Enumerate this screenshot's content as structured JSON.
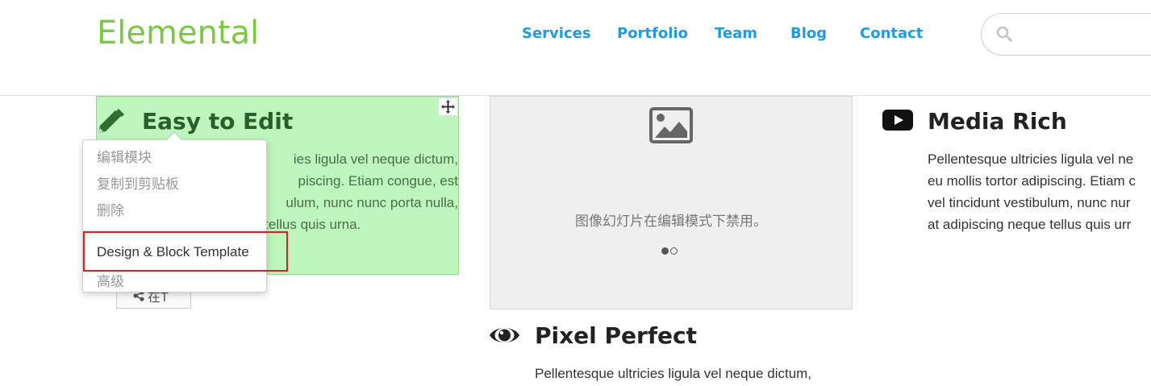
{
  "header": {
    "logo": "Elemental",
    "nav": [
      {
        "label": "Services"
      },
      {
        "label": "Portfolio"
      },
      {
        "label": "Team"
      },
      {
        "label": "Blog"
      },
      {
        "label": "Contact"
      }
    ],
    "search": {
      "placeholder": "",
      "icon": "search-icon"
    }
  },
  "features": {
    "edit": {
      "title": "Easy to Edit",
      "lines": [
        "ies ligula vel neque dictum,",
        "piscing. Etiam congue, est",
        "ulum, nunc nunc porta nulla,",
        "e tellus quis urna."
      ],
      "icon": "pencil-icon",
      "share_label": "在T"
    },
    "slideshow": {
      "message": "图像幻灯片在编辑模式下禁用。",
      "dots": [
        true,
        false
      ],
      "icon": "image-icon"
    },
    "pixel": {
      "title": "Pixel Perfect",
      "text": "Pellentesque ultricies ligula vel neque dictum,",
      "icon": "eye-icon"
    },
    "media": {
      "title": "Media Rich",
      "lines": [
        "Pellentesque ultricies ligula vel ne",
        "eu mollis tortor adipiscing. Etiam c",
        "vel tincidunt vestibulum, nunc nur",
        "at adipiscing neque tellus quis urr"
      ],
      "icon": "youtube-icon"
    }
  },
  "context_menu": {
    "items": [
      {
        "label": "编辑模块"
      },
      {
        "label": "复制到剪贴板"
      },
      {
        "label": "删除"
      },
      {
        "label": "Design & Block Template"
      },
      {
        "label": "高级"
      }
    ]
  },
  "colors": {
    "logo": "#7ac943",
    "nav": "#1e9be6",
    "edit_bg": "#bdf5bd",
    "highlight": "#e02020"
  }
}
